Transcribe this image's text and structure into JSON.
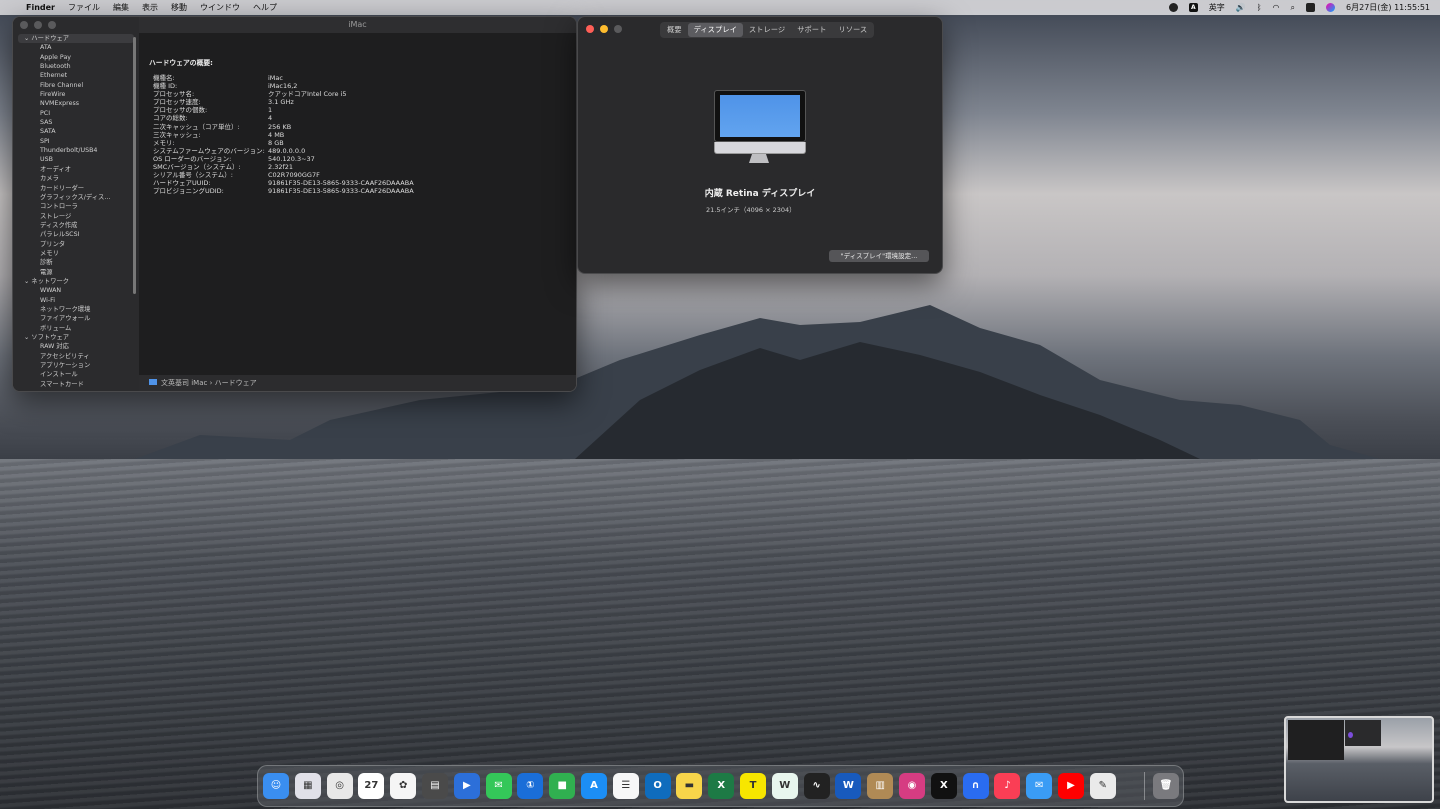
{
  "menubar": {
    "app_name": "Finder",
    "menus": [
      "ファイル",
      "編集",
      "表示",
      "移動",
      "ウインドウ",
      "ヘルプ"
    ],
    "input_mode": "英字",
    "datetime": "6月27日(金) 11:55:51"
  },
  "sysinfo": {
    "window_title": "iMac",
    "sidebar": {
      "hardware_section": "ハードウェア",
      "hardware_items": [
        "ATA",
        "Apple Pay",
        "Bluetooth",
        "Ethernet",
        "Fibre Channel",
        "FireWire",
        "NVMExpress",
        "PCI",
        "SAS",
        "SATA",
        "SPI",
        "Thunderbolt/USB4",
        "USB",
        "オーディオ",
        "カメラ",
        "カードリーダー",
        "グラフィックス/ディス…",
        "コントローラ",
        "ストレージ",
        "ディスク作成",
        "パラレルSCSI",
        "プリンタ",
        "メモリ",
        "診断",
        "電源"
      ],
      "network_section": "ネットワーク",
      "network_items": [
        "WWAN",
        "Wi-Fi",
        "ネットワーク環境",
        "ファイアウォール",
        "ボリューム"
      ],
      "software_section": "ソフトウェア",
      "software_items": [
        "RAW 対応",
        "アクセシビリティ",
        "アプリケーション",
        "インストール",
        "スマートカード"
      ]
    },
    "overview_title": "ハードウェアの概要:",
    "specs": [
      {
        "k": "機種名:",
        "v": "iMac"
      },
      {
        "k": "機種 ID:",
        "v": "iMac16,2"
      },
      {
        "k": "プロセッサ名:",
        "v": "クアッドコアIntel Core i5"
      },
      {
        "k": "プロセッサ速度:",
        "v": "3.1 GHz"
      },
      {
        "k": "プロセッサの個数:",
        "v": "1"
      },
      {
        "k": "コアの総数:",
        "v": "4"
      },
      {
        "k": "二次キャッシュ（コア単位）:",
        "v": "256 KB"
      },
      {
        "k": "三次キャッシュ:",
        "v": "4 MB"
      },
      {
        "k": "メモリ:",
        "v": "8 GB"
      },
      {
        "k": "システムファームウェアのバージョン:",
        "v": "489.0.0.0.0"
      },
      {
        "k": "OS ローダーのバージョン:",
        "v": "540.120.3~37"
      },
      {
        "k": "SMCバージョン（システム）:",
        "v": "2.32f21"
      },
      {
        "k": "シリアル番号（システム）:",
        "v": "C02R7090GG7F"
      },
      {
        "k": "ハードウェアUUID:",
        "v": "91861F35-DE13-5865-9333-CAAF26DAAABA"
      },
      {
        "k": "プロビジョニングUDID:",
        "v": "91861F35-DE13-5865-9333-CAAF26DAAABA"
      }
    ],
    "breadcrumb": "文英基司 iMac › ハードウェア"
  },
  "about": {
    "tabs": [
      "概要",
      "ディスプレイ",
      "ストレージ",
      "サポート",
      "リソース"
    ],
    "active_tab": "ディスプレイ",
    "display_name": "内蔵 Retina ディスプレイ",
    "display_size": "21.5インチ（4096 × 2304）",
    "settings_button": "\"ディスプレイ\"環境設定..."
  },
  "dock": {
    "apps": [
      {
        "name": "Finder",
        "glyph": "☺",
        "color": "#3a8ef0"
      },
      {
        "name": "Launchpad",
        "glyph": "▦",
        "color": "#e0e0e8"
      },
      {
        "name": "Chrome",
        "glyph": "◎",
        "color": "#e8e8e8"
      },
      {
        "name": "Calendar",
        "glyph": "27",
        "color": "#ffffff"
      },
      {
        "name": "Photos",
        "glyph": "✿",
        "color": "#f5f5f5"
      },
      {
        "name": "Calculator",
        "glyph": "▤",
        "color": "#4a4a4a"
      },
      {
        "name": "Keynote",
        "glyph": "▶",
        "color": "#2c6fd9"
      },
      {
        "name": "Messages",
        "glyph": "✉",
        "color": "#34c759"
      },
      {
        "name": "1Password",
        "glyph": "①",
        "color": "#1a6ed8"
      },
      {
        "name": "FaceTime",
        "glyph": "■",
        "color": "#30b050"
      },
      {
        "name": "App Store",
        "glyph": "A",
        "color": "#1c8ef5"
      },
      {
        "name": "Reminders",
        "glyph": "☰",
        "color": "#f7f7f7"
      },
      {
        "name": "Outlook",
        "glyph": "O",
        "color": "#0f6cbd"
      },
      {
        "name": "Notes",
        "glyph": "▬",
        "color": "#f7d54a"
      },
      {
        "name": "Excel",
        "glyph": "X",
        "color": "#1d7a45"
      },
      {
        "name": "KakaoTalk",
        "glyph": "T",
        "color": "#f7e600"
      },
      {
        "name": "Webull",
        "glyph": "W",
        "color": "#e8f6ee"
      },
      {
        "name": "Stocks",
        "glyph": "∿",
        "color": "#222222"
      },
      {
        "name": "Word",
        "glyph": "W",
        "color": "#185abd"
      },
      {
        "name": "Notebook",
        "glyph": "▥",
        "color": "#b08a55"
      },
      {
        "name": "Instagram",
        "glyph": "◉",
        "color": "#d63c82"
      },
      {
        "name": "X",
        "glyph": "X",
        "color": "#111111"
      },
      {
        "name": "Copilot",
        "glyph": "∩",
        "color": "#2a6cf0"
      },
      {
        "name": "Music",
        "glyph": "♪",
        "color": "#fa3e55"
      },
      {
        "name": "Mail",
        "glyph": "✉",
        "color": "#3a9cf5"
      },
      {
        "name": "YouTube",
        "glyph": "▶",
        "color": "#ff0000"
      },
      {
        "name": "Preview",
        "glyph": "✎",
        "color": "#eaeaea"
      },
      {
        "name": "Trash",
        "glyph": "🗑",
        "color": "#7a7a7e"
      }
    ]
  },
  "colors": {
    "window_bg": "#232324",
    "accent_blue": "#4f93e8",
    "traffic_red": "#ff5f57",
    "traffic_yellow": "#febc2e",
    "traffic_green": "#28c840"
  }
}
